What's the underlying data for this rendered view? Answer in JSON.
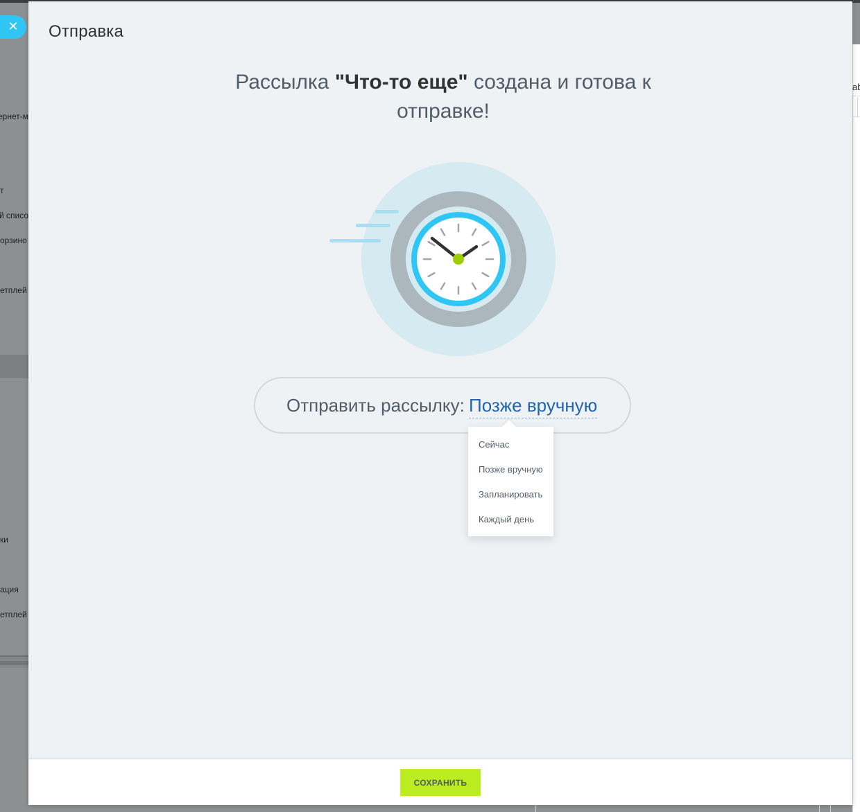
{
  "background": {
    "left_menu_fragments": [
      "ернет-м",
      "т",
      "й списо",
      "орзино",
      "етплей",
      "ки",
      "ация",
      "етплей"
    ],
    "right_fragment": "ab"
  },
  "panel": {
    "title": "Отправка",
    "headline": {
      "prefix": "Рассылка ",
      "name": "\"Что-то еще\"",
      "suffix": " создана и готова к отправке!"
    },
    "send": {
      "label": "Отправить рассылку:",
      "value": "Позже вручную"
    },
    "menu": {
      "items": [
        "Сейчас",
        "Позже вручную",
        "Запланировать",
        "Каждый день"
      ]
    },
    "footer": {
      "save_label": "СОХРАНИТЬ"
    }
  },
  "colors": {
    "accent_blue": "#2fc6f6",
    "link_blue": "#2067b0",
    "save_green": "#bbed21",
    "clock_hand_center": "#9dcf00"
  },
  "icons": {
    "close": "close-icon",
    "clock": "clock-icon"
  }
}
